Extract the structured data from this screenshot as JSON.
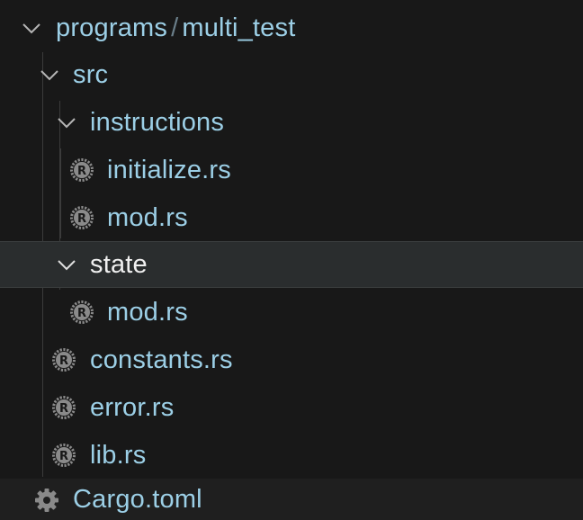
{
  "explorer": {
    "root": {
      "path_parent": "programs",
      "separator": "/",
      "path_child": "multi_test",
      "expanded": true
    },
    "items": [
      {
        "label": "src",
        "kind": "folder",
        "expanded": true
      },
      {
        "label": "instructions",
        "kind": "folder",
        "expanded": true
      },
      {
        "label": "initialize.rs",
        "kind": "file",
        "icon": "rust-file-icon"
      },
      {
        "label": "mod.rs",
        "kind": "file",
        "icon": "rust-file-icon"
      },
      {
        "label": "state",
        "kind": "folder",
        "expanded": true,
        "selected": true
      },
      {
        "label": "mod.rs",
        "kind": "file",
        "icon": "rust-file-icon"
      },
      {
        "label": "constants.rs",
        "kind": "file",
        "icon": "rust-file-icon"
      },
      {
        "label": "error.rs",
        "kind": "file",
        "icon": "rust-file-icon"
      },
      {
        "label": "lib.rs",
        "kind": "file",
        "icon": "rust-file-icon"
      },
      {
        "label": "Cargo.toml",
        "kind": "file",
        "icon": "gear-file-icon"
      }
    ]
  },
  "colors": {
    "background": "#181818",
    "selected_row": "#2a2d2e",
    "label": "#9ccfe6",
    "selected_label": "#f0f0f0",
    "icon": "#8a8a8a",
    "guide": "#3b3b3b"
  }
}
